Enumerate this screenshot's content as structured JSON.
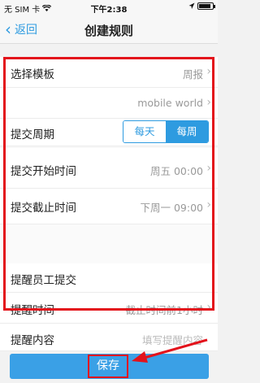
{
  "statusbar": {
    "carrier": "无 SIM 卡",
    "time": "下午2:38",
    "battery_level": 0.85
  },
  "nav": {
    "back_label": "返回",
    "title": "创建规则"
  },
  "rows": {
    "template": {
      "label": "选择模板",
      "value": "周报"
    },
    "recipient": {
      "value": "mobile world"
    },
    "period": {
      "label": "提交周期",
      "option_daily": "每天",
      "option_weekly": "每周",
      "selected": "每周"
    },
    "start_time": {
      "label": "提交开始时间",
      "value": "周五 00:00"
    },
    "end_time": {
      "label": "提交截止时间",
      "value": "下周一 09:00"
    },
    "remind_submit": {
      "label": "提醒员工提交"
    },
    "remind_time": {
      "label": "提醒时间",
      "value": "截止时间前1小时"
    },
    "remind_content": {
      "label": "提醒内容",
      "placeholder": "填写提醒内容"
    }
  },
  "footer": {
    "save_label": "保存"
  },
  "colors": {
    "accent": "#2e9be0",
    "annotation": "#e3121b"
  }
}
